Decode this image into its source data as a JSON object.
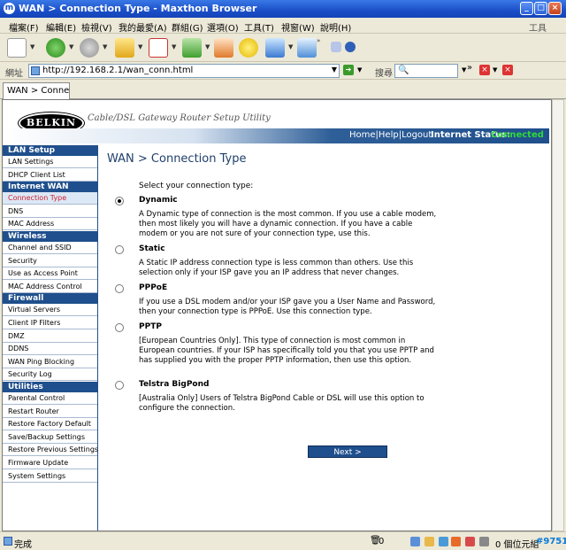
{
  "window": {
    "title": "WAN > Connection Type - Maxthon Browser"
  },
  "menu": {
    "items": [
      "檔案(F)",
      "編輯(E)",
      "檢視(V)",
      "我的最愛(A)",
      "群組(G)",
      "選項(O)",
      "工具(T)",
      "視窗(W)",
      "說明(H)"
    ],
    "tools_label": "工具"
  },
  "address": {
    "label": "網址",
    "url": "http://192.168.2.1/wan_conn.html",
    "search_label": "搜尋"
  },
  "tab": {
    "label": "WAN > Connecti..."
  },
  "header": {
    "logo": "BELKIN",
    "subtitle": "Cable/DSL Gateway Router Setup Utility",
    "links": "Home|Help|Logout",
    "status_label": "Internet Status:",
    "status_value": "Connected",
    "status_color": "#2fd83a"
  },
  "sidebar": {
    "sections": [
      {
        "title": "LAN Setup",
        "items": [
          "LAN Settings",
          "DHCP Client List"
        ]
      },
      {
        "title": "Internet WAN",
        "items": [
          "Connection Type",
          "DNS",
          "MAC Address"
        ]
      },
      {
        "title": "Wireless",
        "items": [
          "Channel and SSID",
          "Security",
          "Use as Access Point",
          "MAC Address Control"
        ]
      },
      {
        "title": "Firewall",
        "items": [
          "Virtual Servers",
          "Client IP Filters",
          "DMZ",
          "DDNS",
          "WAN Ping Blocking",
          "Security Log"
        ]
      },
      {
        "title": "Utilities",
        "items": [
          "Parental Control",
          "Restart Router",
          "Restore Factory Default",
          "Save/Backup Settings",
          "Restore Previous Settings",
          "Firmware Update",
          "System Settings"
        ]
      }
    ],
    "selected": "Connection Type"
  },
  "content": {
    "title": "WAN > Connection Type",
    "prompt": "Select your connection type:",
    "options": [
      {
        "name": "Dynamic",
        "checked": true,
        "desc": "A Dynamic type of connection is the most common. If you use a cable modem, then most likely you will have a dynamic connection. If you have a cable modem or you are not sure of your connection type, use this."
      },
      {
        "name": "Static",
        "checked": false,
        "desc": "A Static IP address connection type is less common than others. Use this selection only if your ISP gave you an IP address that never changes."
      },
      {
        "name": "PPPoE",
        "checked": false,
        "desc": "If you use a DSL modem and/or your ISP gave you a User Name and Password, then your connection type is PPPoE. Use this connection type."
      },
      {
        "name": "PPTP",
        "checked": false,
        "desc": "[European Countries Only]. This type of connection is most common in European countries. If your ISP has specifically told you that you use PPTP and has supplied you with the proper PPTP information, then use this option."
      },
      {
        "name": "Telstra BigPond",
        "checked": false,
        "desc": "[Australia Only] Users of Telstra BigPond Cable or DSL will use this option to configure the connection."
      }
    ],
    "next_label": "Next >"
  },
  "status": {
    "done": "完成",
    "trash": "0",
    "bytes": "0 個位元組",
    "mark": "#9751"
  }
}
